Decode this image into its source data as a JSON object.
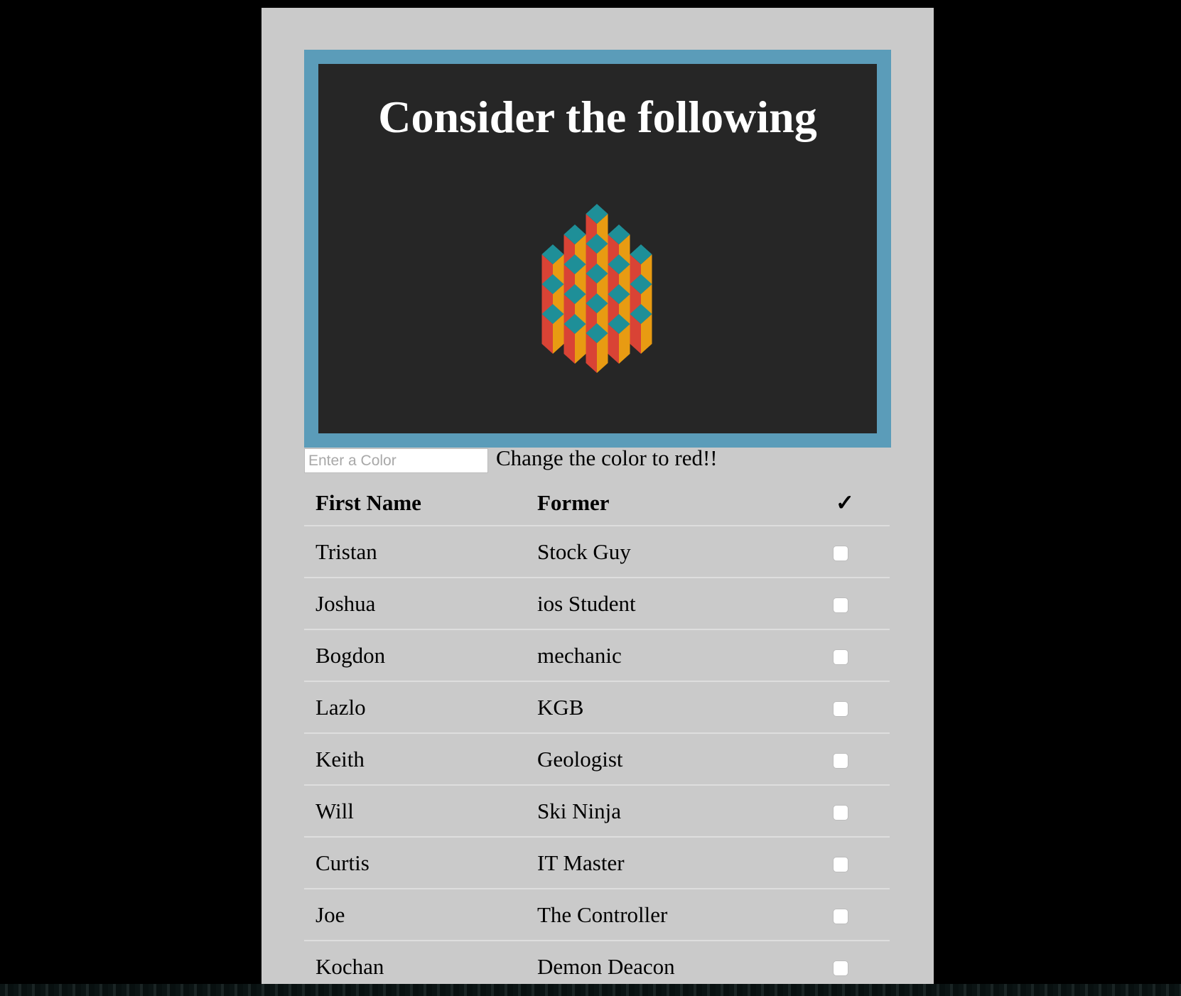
{
  "banner": {
    "title": "Consider the following"
  },
  "color_form": {
    "placeholder": "Enter a Color",
    "value": "",
    "hint": "Change the color to red!!"
  },
  "table": {
    "headers": [
      "First Name",
      "Former",
      "✓"
    ],
    "rows": [
      {
        "first": "Tristan",
        "former": "Stock Guy",
        "checked": false
      },
      {
        "first": "Joshua",
        "former": "ios Student",
        "checked": false
      },
      {
        "first": "Bogdon",
        "former": "mechanic",
        "checked": false
      },
      {
        "first": "Lazlo",
        "former": "KGB",
        "checked": false
      },
      {
        "first": "Keith",
        "former": "Geologist",
        "checked": false
      },
      {
        "first": "Will",
        "former": "Ski Ninja",
        "checked": false
      },
      {
        "first": "Curtis",
        "former": "IT Master",
        "checked": false
      },
      {
        "first": "Joe",
        "former": "The Controller",
        "checked": false
      },
      {
        "first": "Kochan",
        "former": "Demon Deacon",
        "checked": false
      }
    ]
  },
  "colors": {
    "frame": "#5b9cb9",
    "teal": "#1e8f98",
    "red": "#d94335",
    "orange": "#e89b12"
  }
}
